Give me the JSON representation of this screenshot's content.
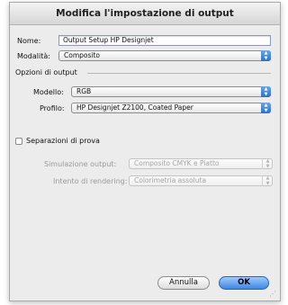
{
  "window": {
    "title": "Modifica l'impostazione di output"
  },
  "form": {
    "name_label": "Nome:",
    "name_value": "Output Setup HP Designjet",
    "mode_label": "Modalità:",
    "mode_value": "Composito"
  },
  "output_options": {
    "section_label": "Opzioni di output",
    "model_label": "Modello:",
    "model_value": "RGB",
    "profile_label": "Profilo:",
    "profile_value": "HP Designjet Z2100, Coated Paper"
  },
  "proof": {
    "checkbox_label": "Separazioni di prova",
    "checked": false,
    "simulation_label": "Simulazione output:",
    "simulation_value": "Composito CMYK e Piatto",
    "intent_label": "Intento di rendering:",
    "intent_value": "Colorimetria assoluta"
  },
  "buttons": {
    "cancel": "Annulla",
    "ok": "OK"
  },
  "icons": {
    "popup_arrows": "up-down-arrows-icon",
    "resize": "resize-grip-icon"
  },
  "colors": {
    "accent": "#3f86e2",
    "dialog_bg": "#ececec"
  }
}
